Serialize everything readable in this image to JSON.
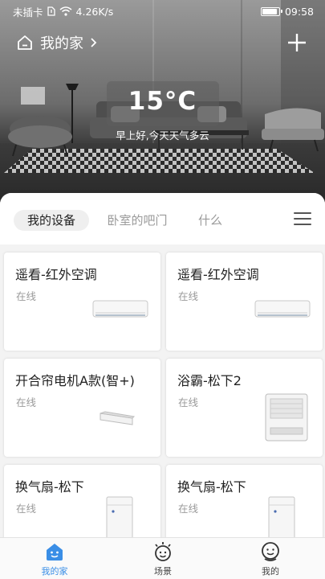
{
  "status_bar": {
    "carrier": "未插卡",
    "network_speed": "4.26K/s",
    "time": "09:58",
    "battery_level": 0.9
  },
  "header": {
    "home_name": "我的家",
    "weather": {
      "temperature": "15°C",
      "greeting": "早上好,今天天气多云"
    }
  },
  "tabs": [
    {
      "label": "我的设备",
      "active": true
    },
    {
      "label": "卧室的吧门",
      "active": false
    },
    {
      "label": "什么",
      "active": false
    }
  ],
  "devices": [
    {
      "name": "遥看-红外空调",
      "status": "在线",
      "icon": "air-conditioner-icon"
    },
    {
      "name": "遥看-红外空调",
      "status": "在线",
      "icon": "air-conditioner-icon"
    },
    {
      "name": "开合帘电机A款(智+)",
      "status": "在线",
      "icon": "curtain-motor-icon"
    },
    {
      "name": "浴霸-松下2",
      "status": "在线",
      "icon": "bath-heater-icon"
    },
    {
      "name": "换气扇-松下",
      "status": "在线",
      "icon": "ventilation-fan-icon"
    },
    {
      "name": "换气扇-松下",
      "status": "在线",
      "icon": "ventilation-fan-icon"
    }
  ],
  "bottom_nav": [
    {
      "label": "我的家",
      "icon": "home-smile-icon",
      "active": true
    },
    {
      "label": "场景",
      "icon": "scene-sun-icon",
      "active": false
    },
    {
      "label": "我的",
      "icon": "profile-face-icon",
      "active": false
    }
  ],
  "colors": {
    "accent": "#3a8ee6",
    "text": "#222222",
    "muted": "#9a9a9a"
  }
}
